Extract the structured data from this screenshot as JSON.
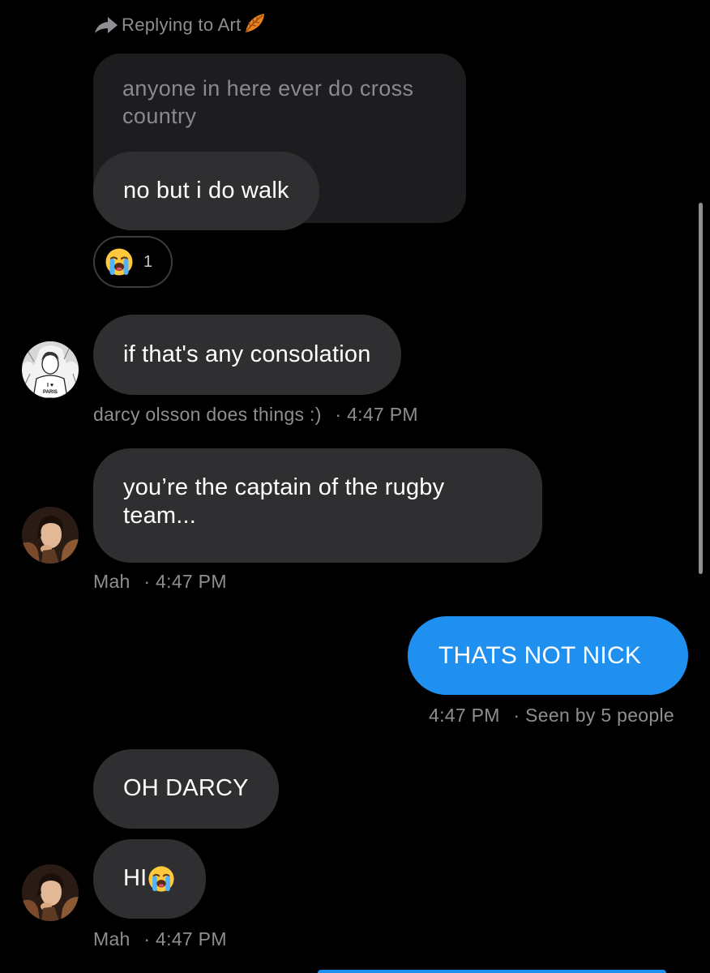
{
  "reply_header": {
    "text": "Replying to Art"
  },
  "quoted_message": {
    "text": "anyone in here ever do cross country"
  },
  "messages": [
    {
      "text": "no but i do walk",
      "reaction": {
        "emoji": "loudly-crying-face",
        "count": "1"
      }
    },
    {
      "text": "if that's any consolation",
      "sender": "darcy olsson does things :)",
      "time": "4:47 PM"
    },
    {
      "text": "you’re the captain of the rugby team...",
      "sender": "Mah",
      "time": "4:47 PM"
    },
    {
      "text": "THATS NOT NICK",
      "time": "4:47 PM",
      "seen": "Seen by 5 people"
    },
    {
      "text": "OH DARCY"
    },
    {
      "text": "HI",
      "emoji": "loudly-crying-face",
      "sender": "Mah",
      "time": "4:47 PM"
    }
  ],
  "meta_separator": "·",
  "colors": {
    "background": "#000000",
    "incoming_bubble": "#2f2f31",
    "outgoing_bubble": "#1f8ff0",
    "meta_text": "#8e8e93"
  }
}
